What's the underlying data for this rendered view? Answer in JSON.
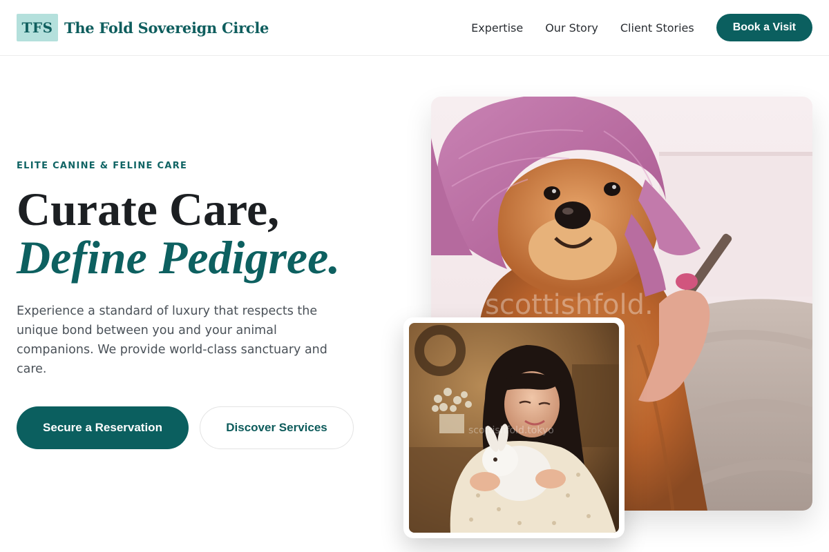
{
  "brand": {
    "mark": "TFS",
    "name": "The Fold Sovereign Circle"
  },
  "nav": {
    "links": [
      "Expertise",
      "Our Story",
      "Client Stories"
    ],
    "cta": "Book a Visit"
  },
  "hero": {
    "eyebrow": "ELITE CANINE & FELINE CARE",
    "headline_line1": "Curate Care,",
    "headline_line2": "Define Pedigree.",
    "lead": "Experience a standard of luxury that respects the unique bond between you and your animal companions. We provide world-class sanctuary and care.",
    "primary_button": "Secure a Reservation",
    "secondary_button": "Discover Services"
  },
  "images": {
    "main_watermark": "scottishfold.",
    "inset_watermark": "scottishfold.tokyo"
  },
  "colors": {
    "brand_teal": "#0b5f5f",
    "logo_bg": "#b4e0dc"
  }
}
